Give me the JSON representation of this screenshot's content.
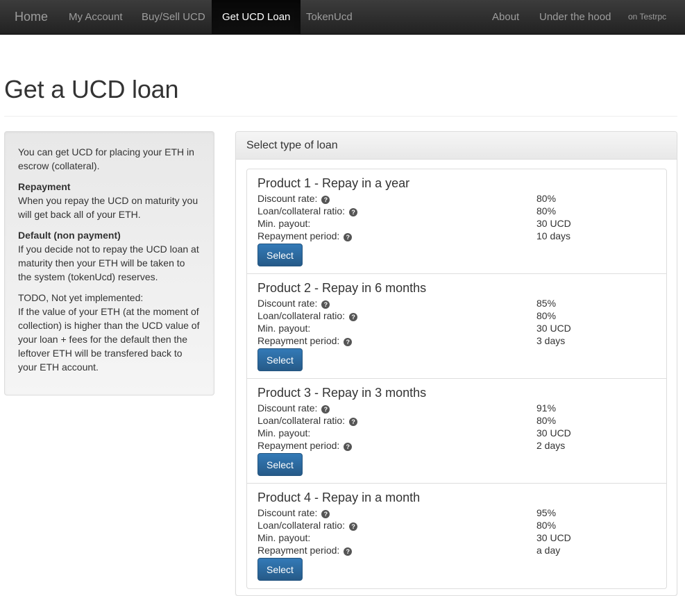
{
  "nav": {
    "brand": "Home",
    "left": [
      "My Account",
      "Buy/Sell UCD",
      "Get UCD Loan",
      "TokenUcd"
    ],
    "active": "Get UCD Loan",
    "right": [
      "About",
      "Under the hood"
    ],
    "network": "on Testrpc"
  },
  "page": {
    "title": "Get a UCD loan"
  },
  "info": {
    "intro": "You can get UCD for placing your ETH in escrow (collateral).",
    "repayment_heading": "Repayment",
    "repayment_text": "When you repay the UCD on maturity you will get back all of your ETH.",
    "default_heading": "Default (non payment)",
    "default_text": "If you decide not to repay the UCD loan at maturity then your ETH will be taken to the system (tokenUcd) reserves.",
    "todo_heading": "TODO, Not yet implemented:",
    "todo_text": "If the value of your ETH (at the moment of collection) is higher than the UCD value of your loan + fees for the default then the leftover ETH will be transfered back to your ETH account."
  },
  "loans": {
    "heading": "Select type of loan",
    "labels": {
      "discount": "Discount rate:",
      "ratio": "Loan/collateral ratio:",
      "min_payout": "Min. payout:",
      "period": "Repayment period:"
    },
    "select_label": "Select",
    "help_icon": "question-circle-icon",
    "products": [
      {
        "title": "Product 1 - Repay in a year",
        "discount": "80%",
        "ratio": "80%",
        "min_payout": "30 UCD",
        "period": "10 days"
      },
      {
        "title": "Product 2 - Repay in 6 months",
        "discount": "85%",
        "ratio": "80%",
        "min_payout": "30 UCD",
        "period": "3 days"
      },
      {
        "title": "Product 3 - Repay in 3 months",
        "discount": "91%",
        "ratio": "80%",
        "min_payout": "30 UCD",
        "period": "2 days"
      },
      {
        "title": "Product 4 - Repay in a month",
        "discount": "95%",
        "ratio": "80%",
        "min_payout": "30 UCD",
        "period": "a day"
      }
    ]
  }
}
